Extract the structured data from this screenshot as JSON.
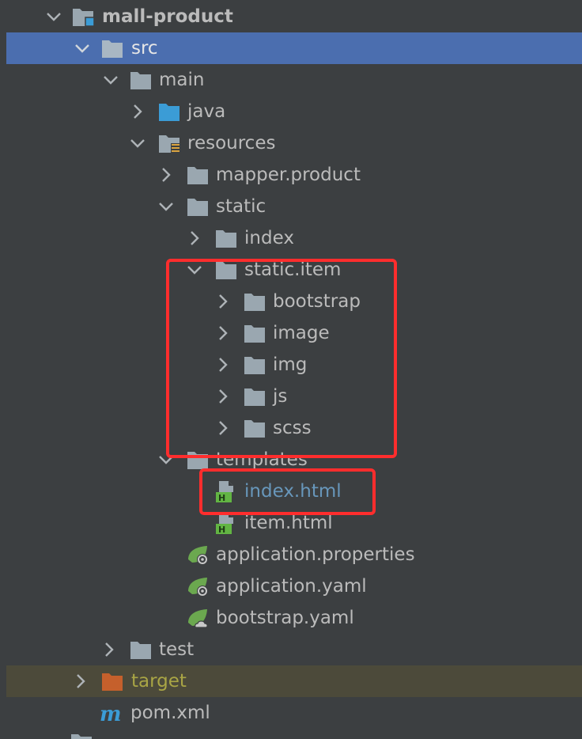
{
  "project_tree": {
    "root": {
      "label": "mall-product",
      "icon": "module-folder-icon",
      "expanded": true
    },
    "nodes": [
      {
        "label": "src",
        "icon": "folder-icon",
        "expanded": true,
        "selected": true
      },
      {
        "label": "main",
        "icon": "folder-icon",
        "expanded": true
      },
      {
        "label": "java",
        "icon": "source-root-folder-icon",
        "expanded": false
      },
      {
        "label": "resources",
        "icon": "resources-root-folder-icon",
        "expanded": true
      },
      {
        "label": "mapper.product",
        "icon": "folder-icon",
        "expanded": false
      },
      {
        "label": "static",
        "icon": "folder-icon",
        "expanded": true
      },
      {
        "label": "index",
        "icon": "folder-icon",
        "expanded": false
      },
      {
        "label": "static.item",
        "icon": "folder-icon",
        "expanded": true
      },
      {
        "label": "bootstrap",
        "icon": "folder-icon",
        "expanded": false
      },
      {
        "label": "image",
        "icon": "folder-icon",
        "expanded": false
      },
      {
        "label": "img",
        "icon": "folder-icon",
        "expanded": false
      },
      {
        "label": "js",
        "icon": "folder-icon",
        "expanded": false
      },
      {
        "label": "scss",
        "icon": "folder-icon",
        "expanded": false
      },
      {
        "label": "templates",
        "icon": "folder-icon",
        "expanded": true
      },
      {
        "label": "index.html",
        "icon": "html-file-icon"
      },
      {
        "label": "item.html",
        "icon": "html-file-icon"
      },
      {
        "label": "application.properties",
        "icon": "spring-config-icon"
      },
      {
        "label": "application.yaml",
        "icon": "spring-config-icon"
      },
      {
        "label": "bootstrap.yaml",
        "icon": "spring-cloud-config-icon"
      },
      {
        "label": "test",
        "icon": "folder-icon",
        "expanded": false
      },
      {
        "label": "target",
        "icon": "excluded-folder-icon",
        "expanded": false
      },
      {
        "label": "pom.xml",
        "icon": "maven-file-icon"
      }
    ]
  },
  "colors": {
    "background": "#3c3f41",
    "selection": "#4b6eaf",
    "excluded_row": "#4c4a3a",
    "text": "#bbbbbb",
    "modified_file_text": "#6897bb",
    "excluded_text": "#a9a545",
    "annotation_red": "#ff2d2d",
    "folder": "#9aa7b0",
    "source_folder": "#3b9cd6",
    "excluded_folder": "#c5602c",
    "maven": "#3b9cd6",
    "spring_green": "#6ba84f"
  }
}
